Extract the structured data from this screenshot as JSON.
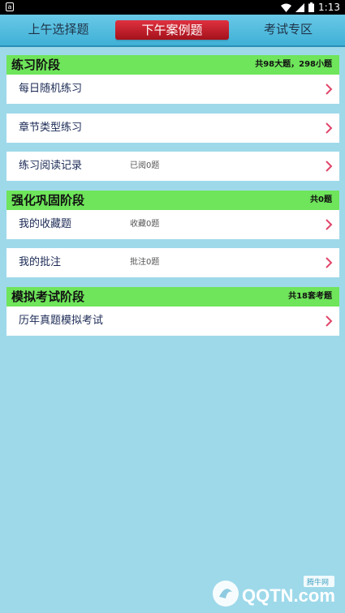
{
  "status": {
    "time": "1:13",
    "app_icon": "a"
  },
  "tabs": [
    {
      "label": "上午选择题"
    },
    {
      "label": "下午案例题"
    },
    {
      "label": "考试专区"
    }
  ],
  "sections": [
    {
      "title": "练习阶段",
      "summary": "共98大题，298小题",
      "items": [
        {
          "label": "每日随机练习",
          "count": ""
        },
        {
          "label": "章节类型练习",
          "count": ""
        },
        {
          "label": "练习阅读记录",
          "count": "已阅0题"
        }
      ]
    },
    {
      "title": "强化巩固阶段",
      "summary": "共0题",
      "items": [
        {
          "label": "我的收藏题",
          "count": "收藏0题"
        },
        {
          "label": "我的批注",
          "count": "批注0题"
        }
      ]
    },
    {
      "title": "模拟考试阶段",
      "summary": "共18套考题",
      "items": [
        {
          "label": "历年真题模拟考试",
          "count": ""
        }
      ]
    }
  ],
  "watermark": {
    "brand": "QQTN.com",
    "tag": "腾牛网"
  },
  "colors": {
    "background": "#9ed9ea",
    "section": "#6ee55a",
    "active_tab": "#c81e2a",
    "chevron": "#e0456a"
  }
}
